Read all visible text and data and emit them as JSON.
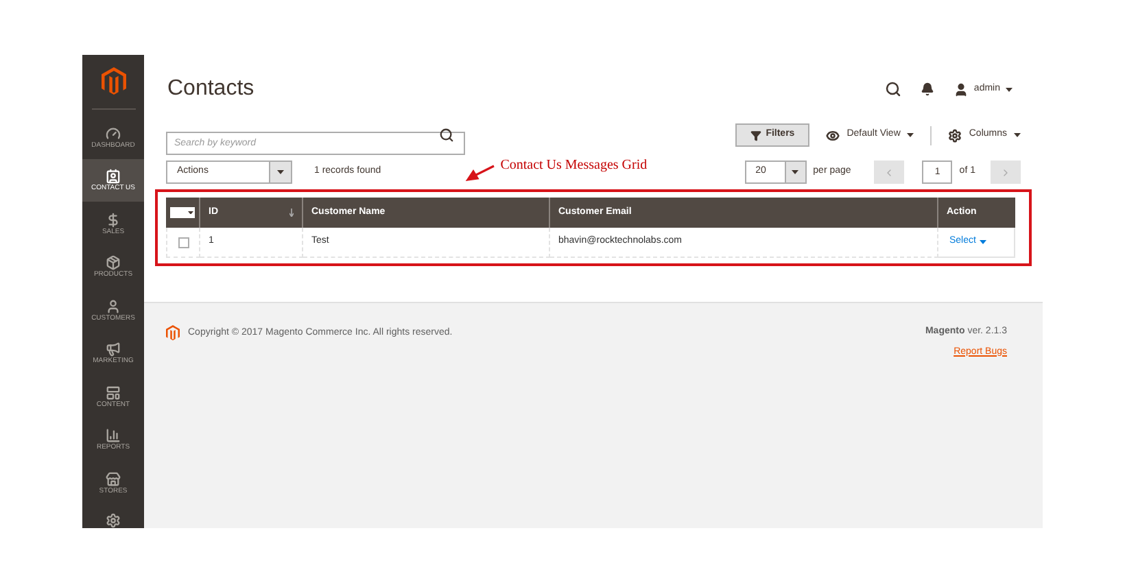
{
  "sidebar": {
    "items": [
      {
        "kind": "dashboard",
        "label": "DASHBOARD",
        "selected": false
      },
      {
        "kind": "contact",
        "label": "CONTACT US",
        "selected": true
      },
      {
        "kind": "sales",
        "label": "SALES",
        "selected": false
      },
      {
        "kind": "products",
        "label": "PRODUCTS",
        "selected": false
      },
      {
        "kind": "customers",
        "label": "CUSTOMERS",
        "selected": false
      },
      {
        "kind": "marketing",
        "label": "MARKETING",
        "selected": false
      },
      {
        "kind": "content",
        "label": "CONTENT",
        "selected": false
      },
      {
        "kind": "reports",
        "label": "REPORTS",
        "selected": false
      },
      {
        "kind": "stores",
        "label": "STORES",
        "selected": false
      }
    ]
  },
  "page_title": "Contacts",
  "user": {
    "name": "admin"
  },
  "search": {
    "placeholder": "Search by keyword"
  },
  "toolbar": {
    "filters": "Filters",
    "view": "Default View",
    "columns": "Columns"
  },
  "actions": {
    "value": "Actions"
  },
  "records_found": "1 records found",
  "annotation": {
    "text": "Contact Us Messages Grid"
  },
  "pager": {
    "per_page_value": "20",
    "per_page_label": "per page",
    "page": "1",
    "of": "of 1"
  },
  "table": {
    "columns": [
      "ID",
      "Customer Name",
      "Customer Email",
      "Action"
    ],
    "rows": [
      {
        "checked": false,
        "cells": [
          "1",
          "Test",
          "bhavin@rocktechnolabs.com"
        ],
        "action": "Select"
      }
    ]
  },
  "footer": {
    "copyright": "Copyright © 2017 Magento Commerce Inc. All rights reserved.",
    "version": "**Magento** ver. 2.1.3",
    "report": "Report Bugs"
  }
}
